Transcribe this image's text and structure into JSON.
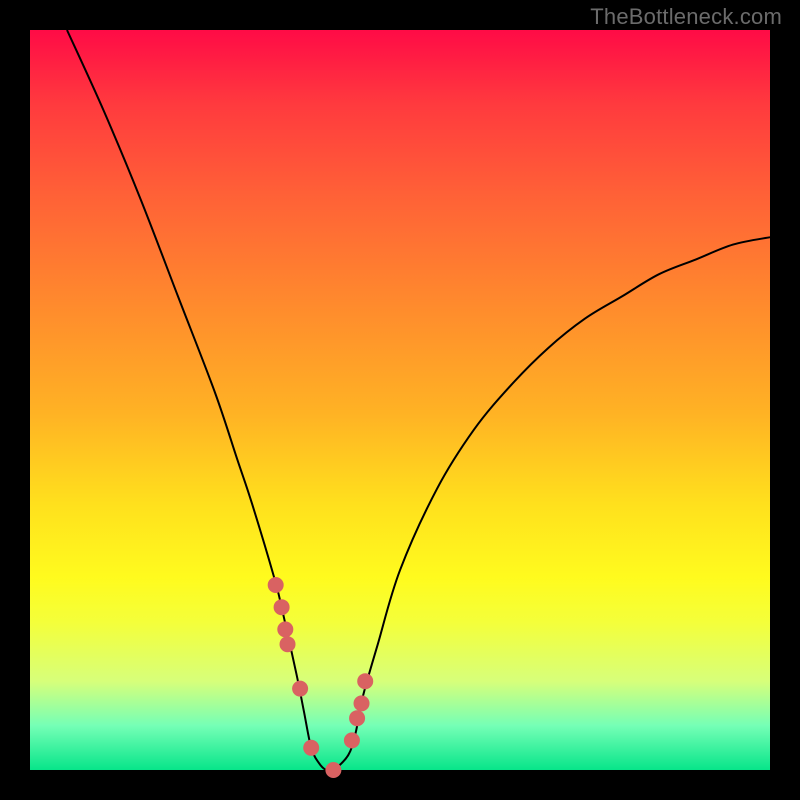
{
  "watermark": "TheBottleneck.com",
  "colors": {
    "frame": "#000000",
    "gradient_top": "#ff0b46",
    "gradient_bottom": "#07e58a",
    "curve": "#000000",
    "markers": "#d96262"
  },
  "chart_data": {
    "type": "line",
    "title": "",
    "xlabel": "",
    "ylabel": "",
    "xlim": [
      0,
      100
    ],
    "ylim": [
      0,
      100
    ],
    "series": [
      {
        "name": "curve",
        "x": [
          5,
          10,
          15,
          20,
          25,
          28,
          30,
          33,
          34,
          36,
          37,
          38,
          39,
          40,
          41,
          43,
          44,
          45,
          47,
          50,
          55,
          60,
          65,
          70,
          75,
          80,
          85,
          90,
          95,
          100
        ],
        "y": [
          100,
          89,
          77,
          64,
          51,
          42,
          36,
          26,
          22,
          13,
          8,
          3,
          1,
          0,
          0,
          2,
          5,
          10,
          17,
          27,
          38,
          46,
          52,
          57,
          61,
          64,
          67,
          69,
          71,
          72
        ]
      }
    ],
    "markers": {
      "name": "highlighted-points",
      "x": [
        33.2,
        34,
        34.5,
        34.8,
        36.5,
        38,
        41,
        43.5,
        44.2,
        44.8,
        45.3
      ],
      "y": [
        25,
        22,
        19,
        17,
        11,
        3,
        0,
        4,
        7,
        9,
        12
      ],
      "radius": 8
    }
  }
}
